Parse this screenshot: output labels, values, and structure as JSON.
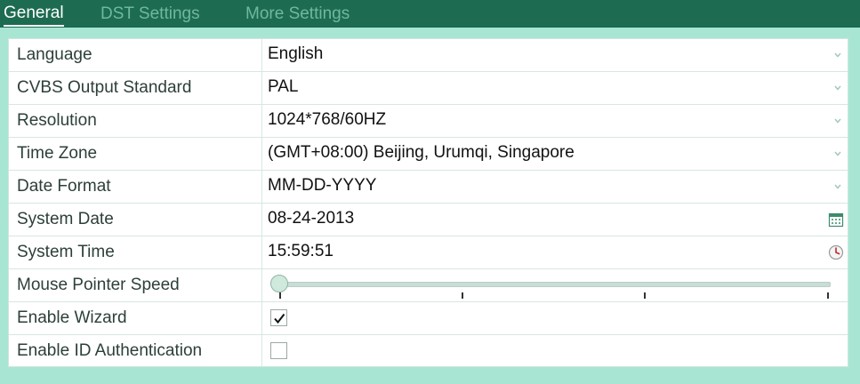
{
  "tabs": [
    {
      "label": "General",
      "active": true
    },
    {
      "label": "DST Settings",
      "active": false
    },
    {
      "label": "More Settings",
      "active": false
    }
  ],
  "rows": [
    {
      "label": "Language",
      "value": "English",
      "control": "dropdown",
      "icon": "chevron-down-icon"
    },
    {
      "label": "CVBS Output Standard",
      "value": "PAL",
      "control": "dropdown",
      "icon": "chevron-down-icon"
    },
    {
      "label": "Resolution",
      "value": "1024*768/60HZ",
      "control": "dropdown",
      "icon": "chevron-down-icon"
    },
    {
      "label": "Time Zone",
      "value": "(GMT+08:00) Beijing, Urumqi, Singapore",
      "control": "dropdown",
      "icon": "chevron-down-icon"
    },
    {
      "label": "Date Format",
      "value": "MM-DD-YYYY",
      "control": "dropdown",
      "icon": "chevron-down-icon"
    },
    {
      "label": "System Date",
      "value": "08-24-2013",
      "control": "date",
      "icon": "calendar-icon"
    },
    {
      "label": "System Time",
      "value": "15:59:51",
      "control": "time",
      "icon": "clock-icon"
    },
    {
      "label": "Mouse Pointer Speed",
      "control": "slider",
      "slider_level": 0,
      "slider_ticks": 4
    },
    {
      "label": "Enable Wizard",
      "control": "checkbox",
      "checked": true
    },
    {
      "label": "Enable ID Authentication",
      "control": "checkbox",
      "checked": false
    }
  ],
  "colors": {
    "header_bg": "#1d6b50",
    "page_bg": "#a8e6d3",
    "active_tab": "#ffffff",
    "inactive_tab": "#6fb89f"
  }
}
